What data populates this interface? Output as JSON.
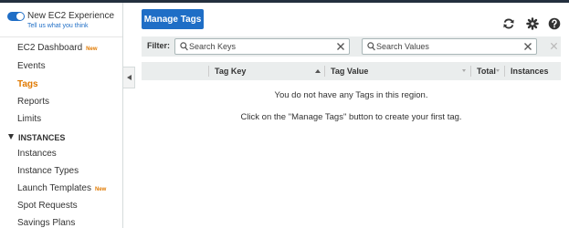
{
  "sidebar": {
    "experience": {
      "title": "New EC2 Experience",
      "subtitle": "Tell us what you think"
    },
    "items": [
      {
        "label": "EC2 Dashboard",
        "badge": "New"
      },
      {
        "label": "Events"
      },
      {
        "label": "Tags",
        "active": true
      },
      {
        "label": "Reports"
      },
      {
        "label": "Limits"
      }
    ],
    "section_instances": {
      "title": "INSTANCES",
      "items": [
        {
          "label": "Instances"
        },
        {
          "label": "Instance Types"
        },
        {
          "label": "Launch Templates",
          "badge": "New"
        },
        {
          "label": "Spot Requests"
        },
        {
          "label": "Savings Plans"
        }
      ]
    }
  },
  "toolbar": {
    "manage_tags_label": "Manage Tags",
    "icons": [
      "refresh-icon",
      "gear-icon",
      "help-icon"
    ]
  },
  "filter": {
    "label": "Filter:",
    "search_keys_placeholder": "Search Keys",
    "search_values_placeholder": "Search Values"
  },
  "table": {
    "columns": [
      "Tag Key",
      "Tag Value",
      "Total",
      "Instances"
    ],
    "empty_message": "You do not have any Tags in this region.",
    "hint_message": "Click on the \"Manage Tags\" button to create your first tag."
  },
  "colors": {
    "accent": "#1f6ec6",
    "active_nav": "#e07900",
    "header_bg": "#eaeded"
  }
}
